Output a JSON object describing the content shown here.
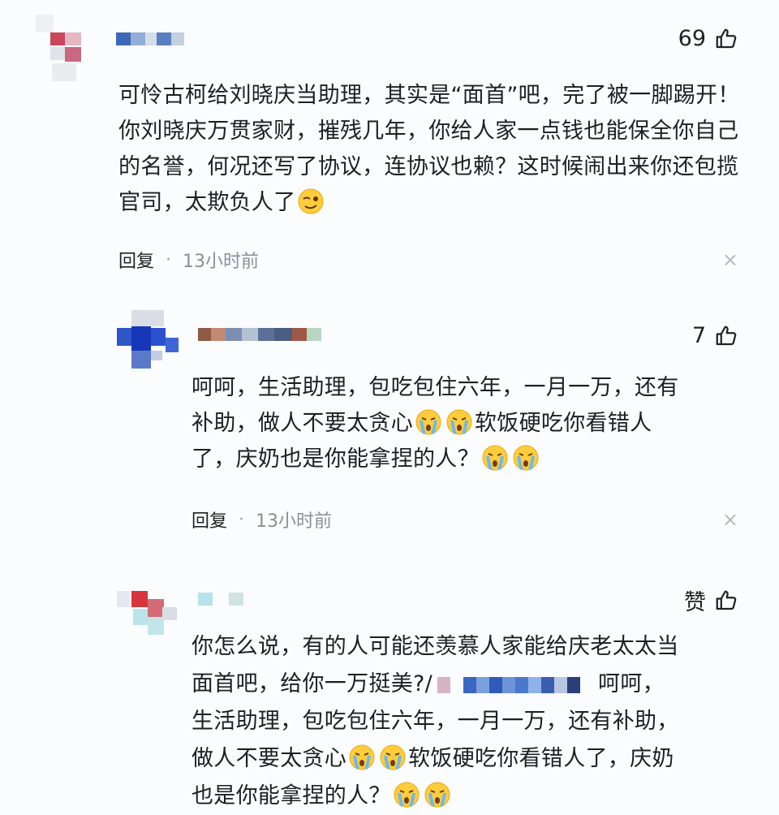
{
  "comments": [
    {
      "likes": "69",
      "text": "可怜古柯给刘晓庆当助理，其实是“面首”吧，完了被一脚踢开！你刘晓庆万贯家财，摧残几年，你给人家一点钱也能保全你自己的名誉，何况还写了协议，连协议也赖？这时候闹出来你还包揽官司，太欺负人了",
      "reply_label": "回复",
      "time": "13小时前",
      "close": "×"
    },
    {
      "likes": "7",
      "text_line1": "呵呵，生活助理，包吃包住六年，一月一万，还有",
      "text_line2a": "补助，做人不要太贪心",
      "text_line2b": "软饭硬吃你看错人",
      "text_line3": "了，庆奶也是你能拿捏的人？",
      "reply_label": "回复",
      "time": "13小时前",
      "close": "×"
    },
    {
      "likes": "赞",
      "line1": "你怎么说，有的人可能还羡慕人家能给庆老太太当",
      "line2a": "面首吧，给你一万挺美?/",
      "line2b": "呵呵，",
      "line3": "生活助理，包吃包住六年，一月一万，还有补助，",
      "line4a": "做人不要太贪心",
      "line4b": "软饭硬吃你看错人了，庆奶",
      "line5": "也是你能拿捏的人？"
    }
  ],
  "icons": {
    "thumb": "thumbs-up-icon",
    "emoji_wink": "wink-emoji-icon",
    "emoji_cry": "crying-emoji-icon"
  },
  "colors": {
    "background": "#fbfcfd",
    "text": "#1c1f24",
    "time": "#8a9099"
  }
}
